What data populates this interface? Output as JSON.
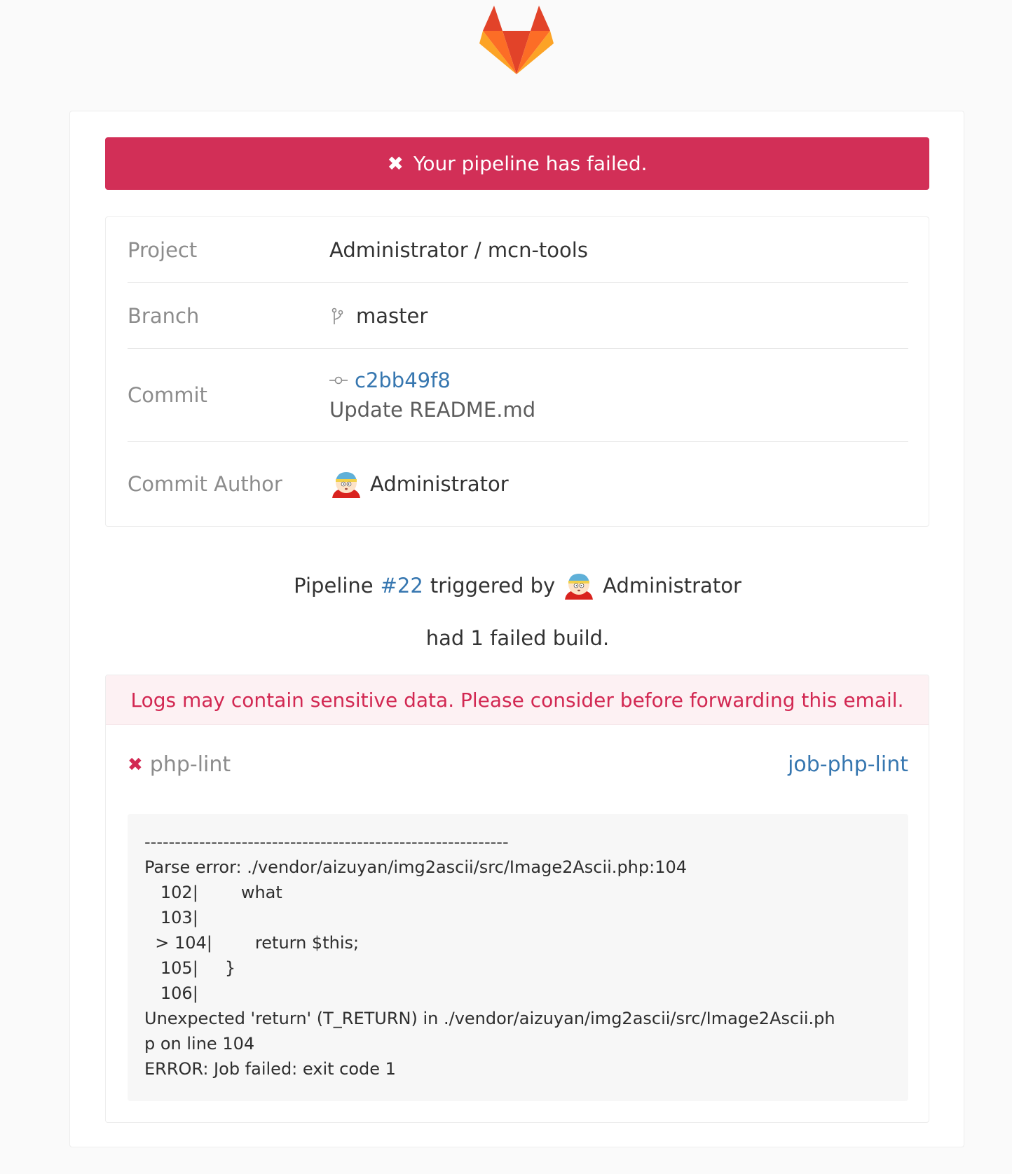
{
  "banner": {
    "icon": "x-icon",
    "text": "Your pipeline has failed."
  },
  "info": {
    "project_label": "Project",
    "project_value": "Administrator / mcn-tools",
    "branch_label": "Branch",
    "branch_value": "master",
    "commit_label": "Commit",
    "commit_sha": "c2bb49f8",
    "commit_message": "Update README.md",
    "author_label": "Commit Author",
    "author_name": "Administrator"
  },
  "summary": {
    "pipeline_prefix": "Pipeline",
    "pipeline_id": "#22",
    "triggered_by": "triggered by",
    "user": "Administrator",
    "result": "had 1 failed build."
  },
  "warning": "Logs may contain sensitive data. Please consider before forwarding this email.",
  "job": {
    "name": "php-lint",
    "link": "job-php-lint",
    "log_lines": [
      "------------------------------------------------------------",
      "Parse error: ./vendor/aizuyan/img2ascii/src/Image2Ascii.php:104",
      "   102|        what",
      "   103|",
      "  > 104|        return $this;",
      "   105|     }",
      "   106|",
      "Unexpected 'return' (T_RETURN) in ./vendor/aizuyan/img2ascii/src/Image2Ascii.ph",
      "p on line 104",
      "ERROR: Job failed: exit code 1"
    ]
  },
  "colors": {
    "failed": "#d22f57",
    "link": "#3777b0",
    "muted": "#8c8c8c"
  }
}
